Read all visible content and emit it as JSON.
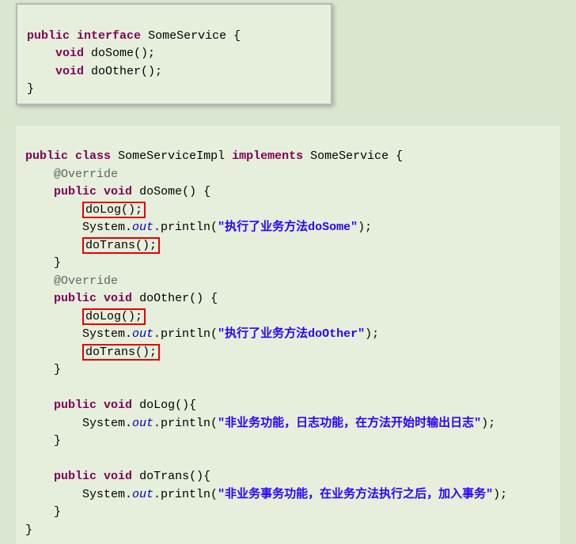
{
  "top": {
    "kw_public": "public",
    "kw_interface": "interface",
    "name": "SomeService",
    "open": " {",
    "kw_void": "void",
    "m1": " doSome();",
    "m2": " doOther();",
    "close": "}"
  },
  "bot": {
    "kw_public": "public",
    "kw_class": "class",
    "name": "SomeServiceImpl",
    "kw_implements": "implements",
    "iface": "SomeService",
    "open": " {",
    "ann": "@Override",
    "kw_void": "void",
    "m_doSome": " doSome() {",
    "m_doOther": " doOther() {",
    "m_doLog": " doLog(){",
    "m_doTrans": " doTrans(){",
    "call_doLog": "doLog();",
    "call_doTrans": "doTrans();",
    "sys": "System.",
    "out": "out",
    "print": ".println(",
    "s_doSome": "\"执行了业务方法doSome\"",
    "s_doOther": "\"执行了业务方法doOther\"",
    "s_log": "\"非业务功能，日志功能，在方法开始时输出日志\"",
    "s_trans": "\"非业务事务功能，在业务方法执行之后，加入事务\"",
    "end": ");",
    "brace_close": "}",
    "close": "}"
  }
}
